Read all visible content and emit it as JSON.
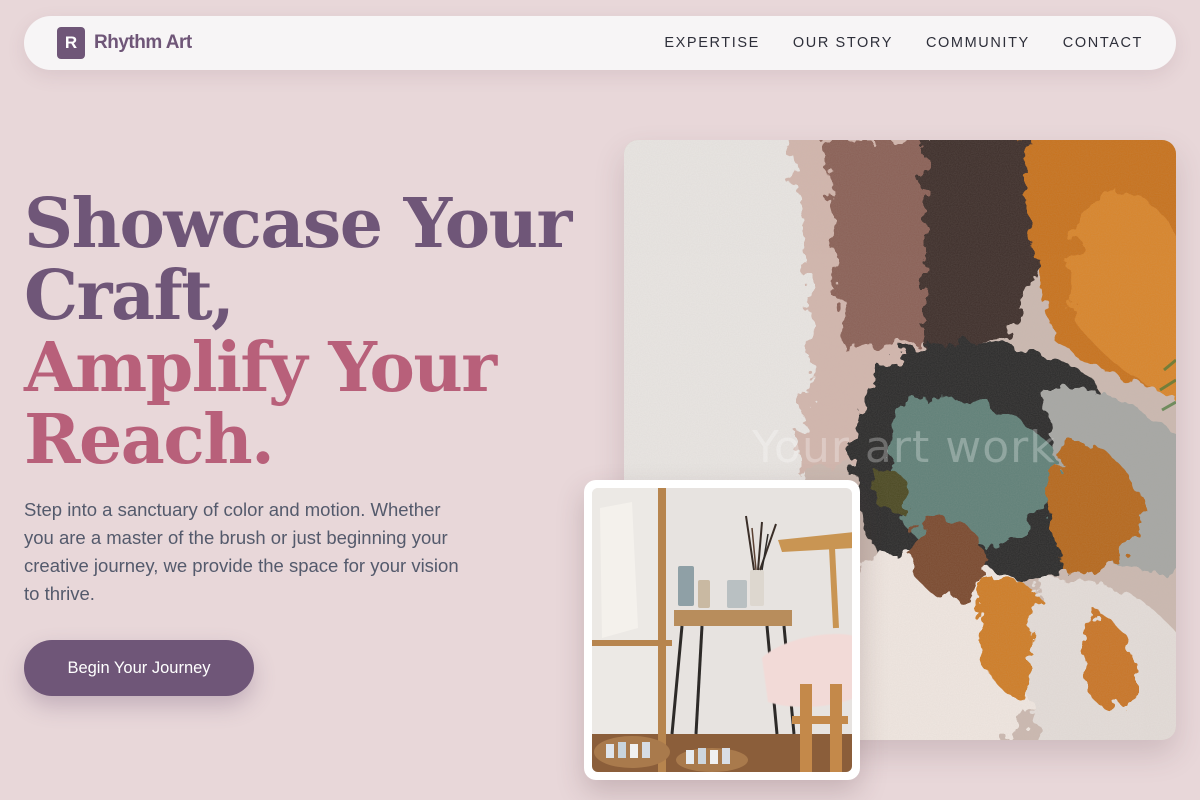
{
  "brand": {
    "logo_letter": "R",
    "name": "Rhythm Art"
  },
  "nav": {
    "items": [
      {
        "label": "EXPERTISE"
      },
      {
        "label": "OUR STORY"
      },
      {
        "label": "COMMUNITY"
      },
      {
        "label": "CONTACT"
      }
    ]
  },
  "hero": {
    "headline_line1": "Showcase Your",
    "headline_line2": "Craft,",
    "headline_line3": "Amplify Your",
    "headline_line4": "Reach.",
    "lead": "Step into a sanctuary of color and motion. Whether you are a master of the brush or just beginning your creative journey, we provide the space for your vision to thrive.",
    "cta_label": "Begin Your Journey"
  },
  "images": {
    "painting": {
      "icon": "impasto-painting-image",
      "watermark": "Your art work"
    },
    "studio": {
      "icon": "art-studio-photo"
    }
  },
  "colors": {
    "page_background": "#e8d7d9",
    "brand_purple": "#6f5678",
    "accent_rose": "#b8607a",
    "body_text": "#545a6c",
    "nav_background": "#f7f5f6"
  }
}
